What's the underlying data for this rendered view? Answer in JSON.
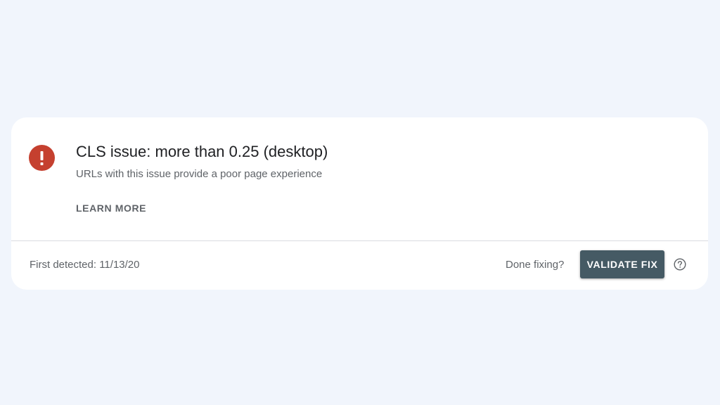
{
  "issue": {
    "status_icon": "error-icon",
    "status_color": "#c5402f",
    "title": "CLS issue: more than 0.25 (desktop)",
    "subtitle": "URLs with this issue provide a poor page experience",
    "learn_more_label": "LEARN MORE"
  },
  "footer": {
    "first_detected": "First detected: 11/13/20",
    "done_fixing_prompt": "Done fixing?",
    "validate_button_label": "VALIDATE FIX",
    "validate_button_color": "#455a64",
    "help_icon": "help-circle-icon"
  },
  "background_color": "#f1f5fc"
}
